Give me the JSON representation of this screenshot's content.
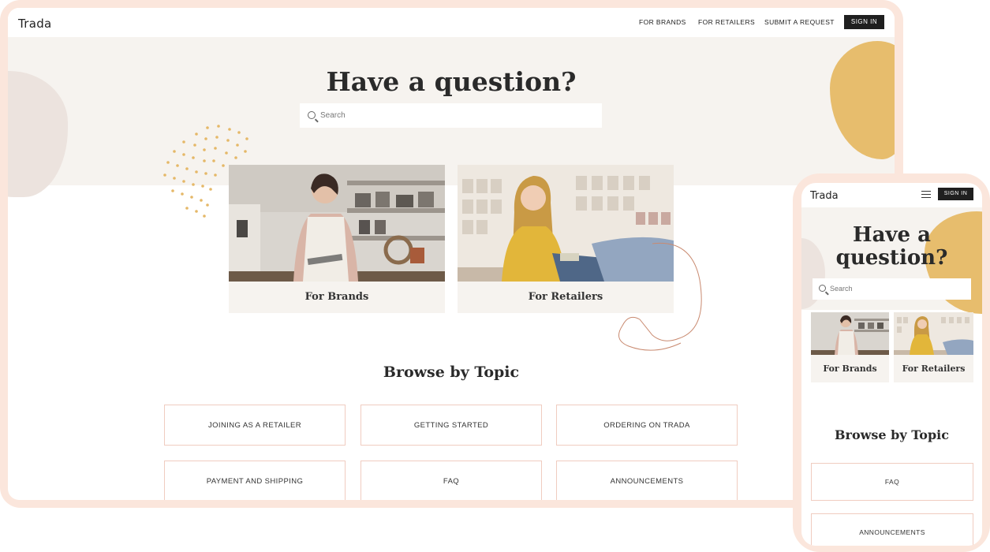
{
  "desktop": {
    "logo": "Trada",
    "nav": [
      "FOR BRANDS",
      "FOR RETAILERS",
      "SUBMIT A REQUEST"
    ],
    "signin": "SIGN IN",
    "hero_title": "Have a question?",
    "search_placeholder": "Search",
    "cards": [
      {
        "label": "For Brands"
      },
      {
        "label": "For Retailers"
      }
    ],
    "browse_title": "Browse by Topic",
    "topics": [
      "JOINING AS A RETAILER",
      "GETTING STARTED",
      "ORDERING ON TRADA",
      "PAYMENT AND SHIPPING",
      "FAQ",
      "ANNOUNCEMENTS"
    ]
  },
  "mobile": {
    "logo": "Trada",
    "signin": "SIGN IN",
    "hero_title_line1": "Have a",
    "hero_title_line2": "question?",
    "search_placeholder": "Search",
    "cards": [
      {
        "label": "For Brands"
      },
      {
        "label": "For Retailers"
      }
    ],
    "browse_title": "Browse by Topic",
    "topics": [
      "FAQ",
      "ANNOUNCEMENTS"
    ]
  },
  "colors": {
    "frame": "#fbe6dc",
    "hero_bg": "#f6f3ef",
    "accent_yellow": "#e7bd6d",
    "dark": "#1f1f1f",
    "topic_border": "#f0ccc0",
    "squiggle": "#c98a70"
  }
}
